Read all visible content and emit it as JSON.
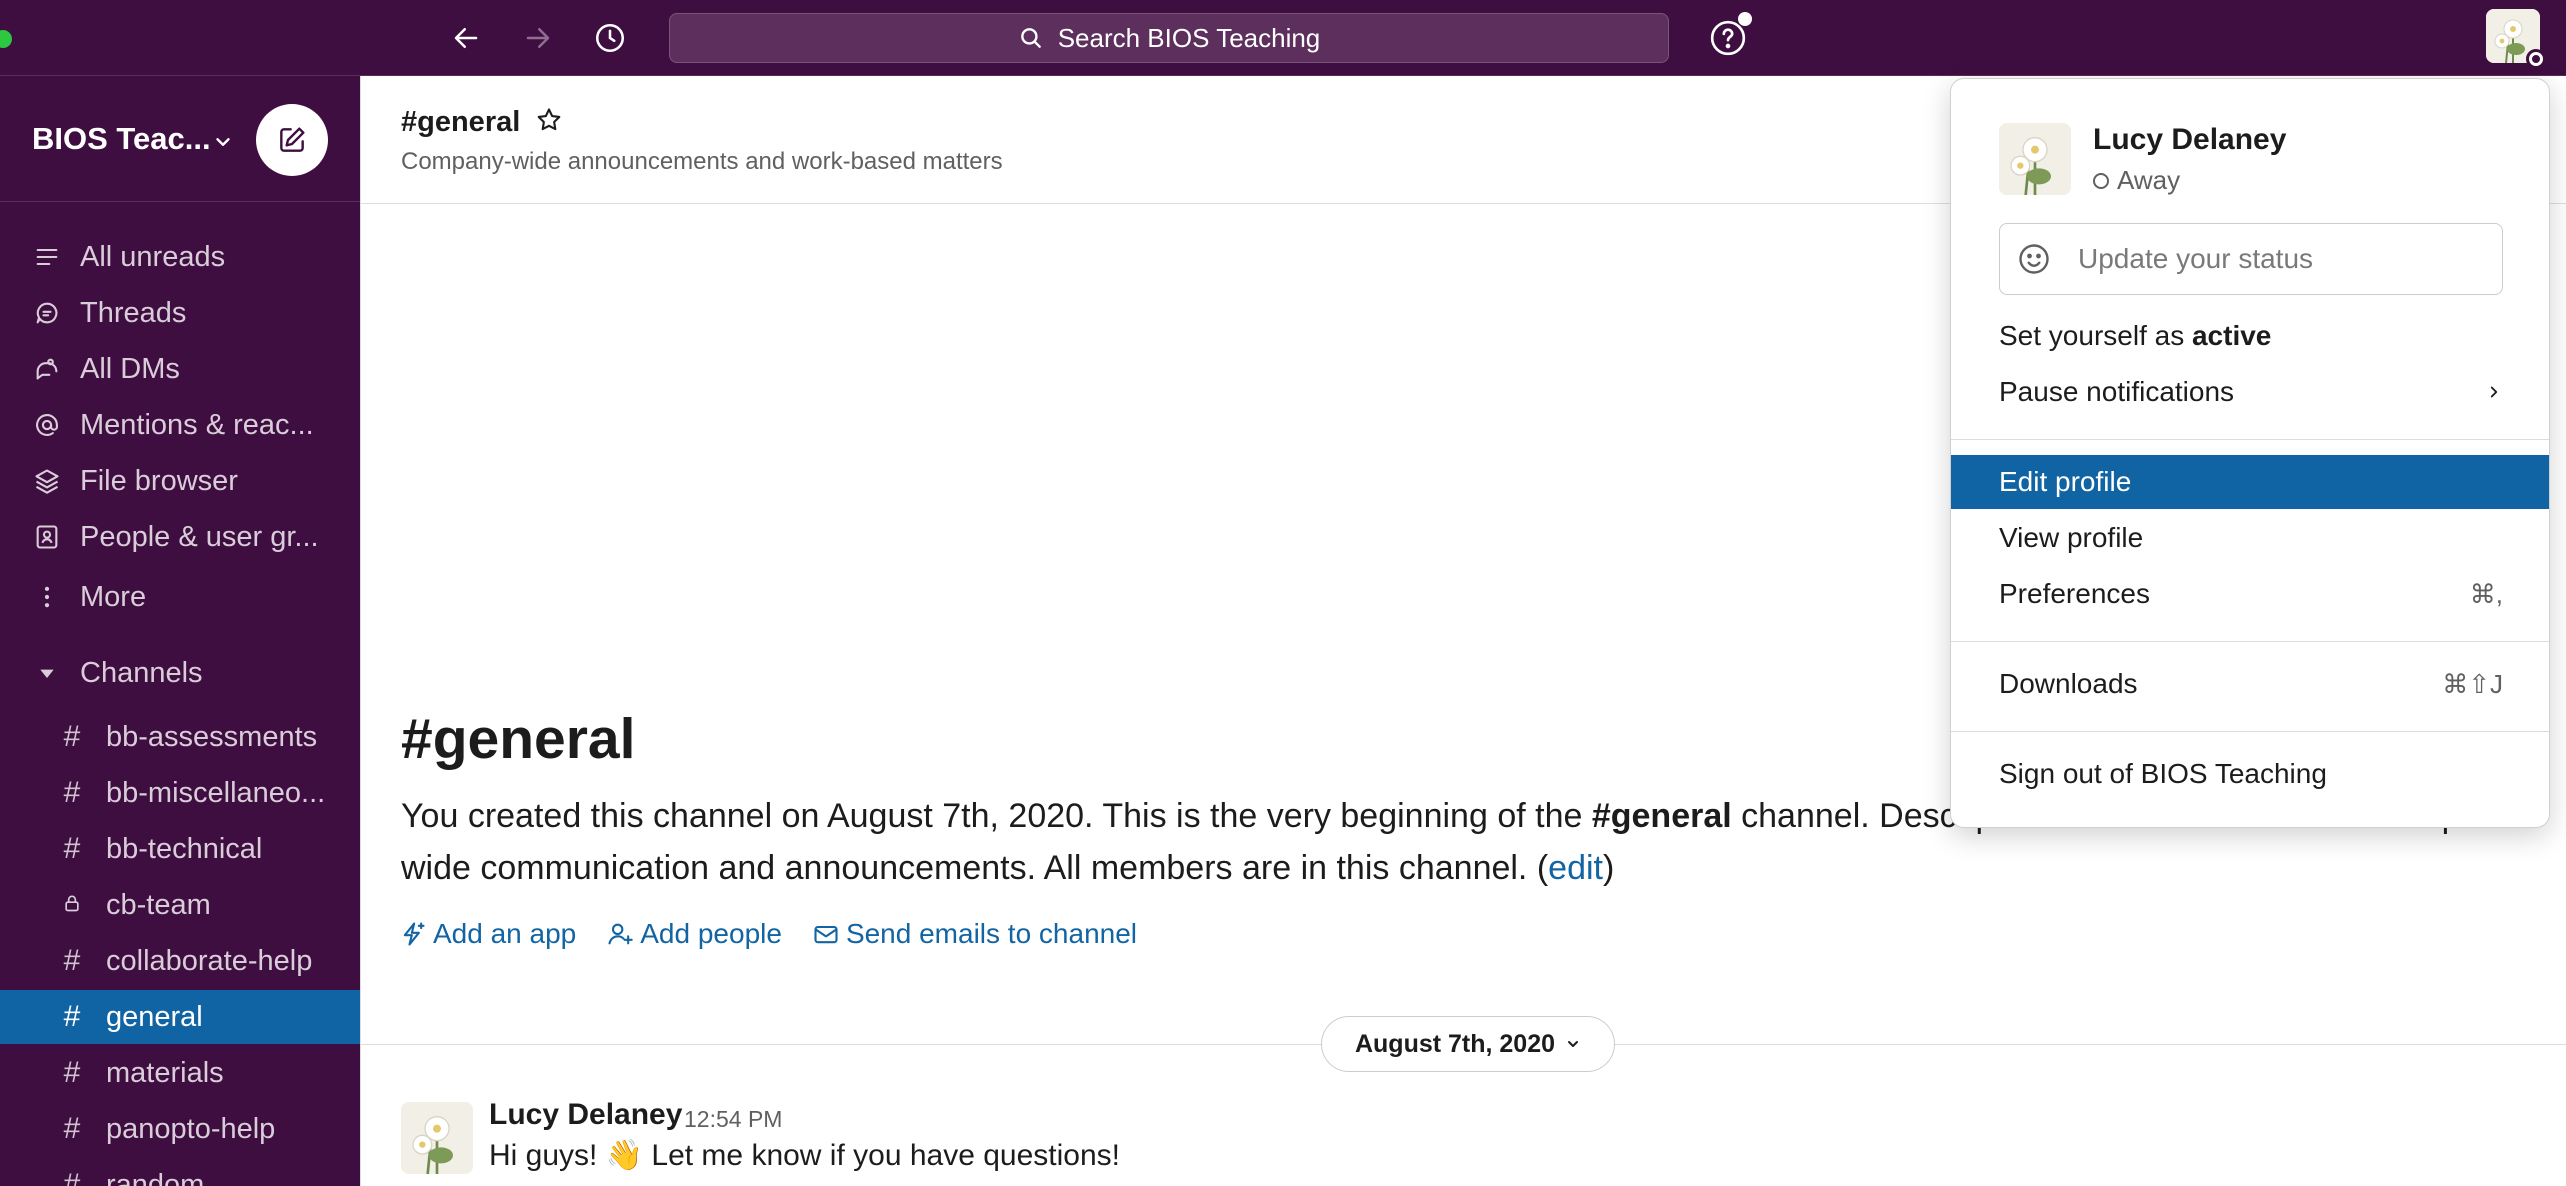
{
  "topbar": {
    "search_placeholder": "Search BIOS Teaching",
    "icons": [
      "back-arrow-icon",
      "forward-arrow-icon",
      "history-icon",
      "search-icon",
      "help-icon",
      "user-avatar-icon"
    ]
  },
  "sidebar": {
    "workspace_name": "BIOS Teac...",
    "nav_items": [
      {
        "label": "All unreads",
        "icon": "all-unreads-icon"
      },
      {
        "label": "Threads",
        "icon": "threads-icon"
      },
      {
        "label": "All DMs",
        "icon": "dms-icon"
      },
      {
        "label": "Mentions & reac...",
        "icon": "mention-icon"
      },
      {
        "label": "File browser",
        "icon": "layers-icon"
      },
      {
        "label": "People & user gr...",
        "icon": "people-icon"
      },
      {
        "label": "More",
        "icon": "more-icon"
      }
    ],
    "channels_label": "Channels",
    "channels": [
      {
        "name": "bb-assessments",
        "prefix": "#"
      },
      {
        "name": "bb-miscellaneo...",
        "prefix": "#"
      },
      {
        "name": "bb-technical",
        "prefix": "#"
      },
      {
        "name": "cb-team",
        "prefix": "lock"
      },
      {
        "name": "collaborate-help",
        "prefix": "#"
      },
      {
        "name": "general",
        "prefix": "#",
        "active": true
      },
      {
        "name": "materials",
        "prefix": "#"
      },
      {
        "name": "panopto-help",
        "prefix": "#"
      },
      {
        "name": "random",
        "prefix": "#"
      }
    ]
  },
  "channel": {
    "title": "#general",
    "description": "Company-wide announcements and work-based matters",
    "intro_title": "#general",
    "intro_part1": "You created this channel on August 7th, 2020. This is the very beginning of the ",
    "intro_bold": "#general",
    "intro_part2": " channel. Description: This channel is for workspace-wide communication and announcements. All members are in this channel. (",
    "intro_edit": "edit",
    "intro_close": ")",
    "actions": [
      {
        "label": "Add an app",
        "icon": "add-app-icon"
      },
      {
        "label": "Add people",
        "icon": "add-person-icon"
      },
      {
        "label": "Send emails to channel",
        "icon": "email-icon"
      }
    ],
    "date_divider": "August 7th, 2020"
  },
  "message": {
    "author": "Lucy Delaney",
    "time": "12:54 PM",
    "text": "Hi guys! 👋 Let me know if you have questions!"
  },
  "profile_menu": {
    "name": "Lucy Delaney",
    "status": "Away",
    "status_placeholder": "Update your status",
    "set_active_prefix": "Set yourself as ",
    "set_active_bold": "active",
    "pause_notifications": "Pause notifications",
    "edit_profile": "Edit profile",
    "view_profile": "View profile",
    "preferences": "Preferences",
    "preferences_shortcut": "⌘,",
    "downloads": "Downloads",
    "downloads_shortcut": "⌘⇧J",
    "sign_out": "Sign out of BIOS Teaching"
  },
  "colors": {
    "sidebar_bg": "#3f0e40",
    "active_blue": "#1164a3",
    "link_blue": "#1264a3"
  }
}
